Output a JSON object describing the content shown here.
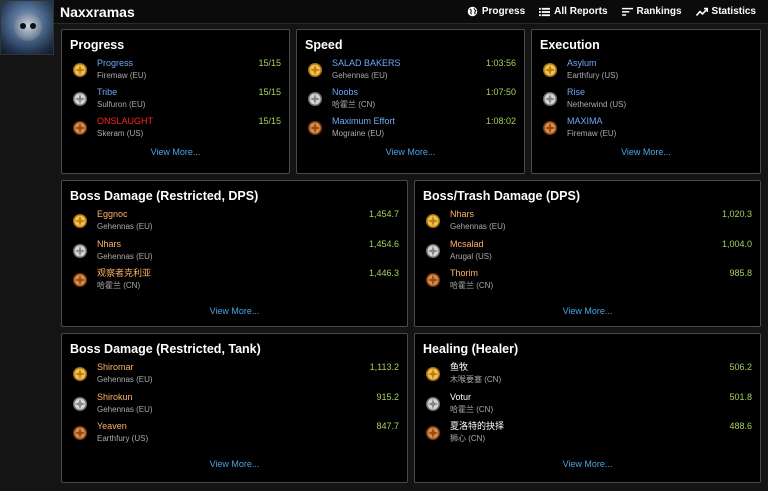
{
  "header": {
    "zone_name": "Naxxramas",
    "nav": [
      {
        "label": "Progress",
        "icon": "globe-icon"
      },
      {
        "label": "All Reports",
        "icon": "list-icon"
      },
      {
        "label": "Rankings",
        "icon": "sort-icon"
      },
      {
        "label": "Statistics",
        "icon": "trend-icon"
      }
    ]
  },
  "colors": {
    "accent_link": "#4aa4e8",
    "value_green": "#a6d060",
    "gold": "#d9a520",
    "silver": "#b0b0b0",
    "bronze": "#b86a2a"
  },
  "panels": {
    "progress": {
      "title": "Progress",
      "view_more": "View More...",
      "rows": [
        {
          "medal": "gold",
          "name": "Progress",
          "server": "Firemaw (EU)",
          "value": "15/15",
          "color": "#6fa8f7"
        },
        {
          "medal": "silver",
          "name": "Tribe",
          "server": "Sulfuron (EU)",
          "value": "15/15",
          "color": "#6fa8f7"
        },
        {
          "medal": "bronze",
          "name": "ONSLAUGHT",
          "server": "Skeram (US)",
          "value": "15/15",
          "color": "#ff2424"
        }
      ]
    },
    "speed": {
      "title": "Speed",
      "view_more": "View More...",
      "rows": [
        {
          "medal": "gold",
          "name": "SALAD BAKERS",
          "server": "Gehennas (EU)",
          "value": "1:03:56",
          "color": "#6fa8f7"
        },
        {
          "medal": "silver",
          "name": "Noobs",
          "server": "哈霍兰 (CN)",
          "value": "1:07:50",
          "color": "#6fa8f7"
        },
        {
          "medal": "bronze",
          "name": "Maximum Effort",
          "server": "Mograine (EU)",
          "value": "1:08:02",
          "color": "#6fa8f7"
        }
      ]
    },
    "execution": {
      "title": "Execution",
      "view_more": "View More...",
      "rows": [
        {
          "medal": "gold",
          "name": "Asylum",
          "server": "Earthfury (US)",
          "value": "",
          "color": "#6fa8f7"
        },
        {
          "medal": "silver",
          "name": "Rise",
          "server": "Netherwind (US)",
          "value": "",
          "color": "#6fa8f7"
        },
        {
          "medal": "bronze",
          "name": "MAXIMA",
          "server": "Firemaw (EU)",
          "value": "",
          "color": "#6fa8f7"
        }
      ]
    },
    "boss_dps": {
      "title": "Boss Damage (Restricted, DPS)",
      "view_more": "View More...",
      "rows": [
        {
          "medal": "gold",
          "name": "Eggnoc",
          "server": "Gehennas (EU)",
          "value": "1,454.7",
          "color": "#ffb266"
        },
        {
          "medal": "silver",
          "name": "Nhars",
          "server": "Gehennas (EU)",
          "value": "1,454.6",
          "color": "#ffb266"
        },
        {
          "medal": "bronze",
          "name": "观察者克利亚",
          "server": "哈霍兰 (CN)",
          "value": "1,446.3",
          "color": "#ffb266"
        }
      ]
    },
    "trash_dps": {
      "title": "Boss/Trash Damage (DPS)",
      "view_more": "View More...",
      "rows": [
        {
          "medal": "gold",
          "name": "Nhars",
          "server": "Gehennas (EU)",
          "value": "1,020.3",
          "color": "#ffb266"
        },
        {
          "medal": "silver",
          "name": "Mcsalad",
          "server": "Arugal (US)",
          "value": "1,004.0",
          "color": "#ffb266"
        },
        {
          "medal": "bronze",
          "name": "Thorim",
          "server": "哈霍兰 (CN)",
          "value": "985.8",
          "color": "#ffb266"
        }
      ]
    },
    "boss_tank": {
      "title": "Boss Damage (Restricted, Tank)",
      "view_more": "View More...",
      "rows": [
        {
          "medal": "gold",
          "name": "Shiromar",
          "server": "Gehennas (EU)",
          "value": "1,113.2",
          "color": "#ffb266"
        },
        {
          "medal": "silver",
          "name": "Shirokun",
          "server": "Gehennas (EU)",
          "value": "915.2",
          "color": "#ffb266"
        },
        {
          "medal": "bronze",
          "name": "Yeaven",
          "server": "Earthfury (US)",
          "value": "847.7",
          "color": "#ffb266"
        }
      ]
    },
    "healing": {
      "title": "Healing (Healer)",
      "view_more": "View More...",
      "rows": [
        {
          "medal": "gold",
          "name": "鱼牧",
          "server": "木喉要塞 (CN)",
          "value": "506.2",
          "color": "#ffffff"
        },
        {
          "medal": "silver",
          "name": "Votur",
          "server": "哈霍兰 (CN)",
          "value": "501.8",
          "color": "#ffffff"
        },
        {
          "medal": "bronze",
          "name": "夏洛特的抉择",
          "server": "狮心 (CN)",
          "value": "488.6",
          "color": "#ffffff"
        }
      ]
    }
  }
}
